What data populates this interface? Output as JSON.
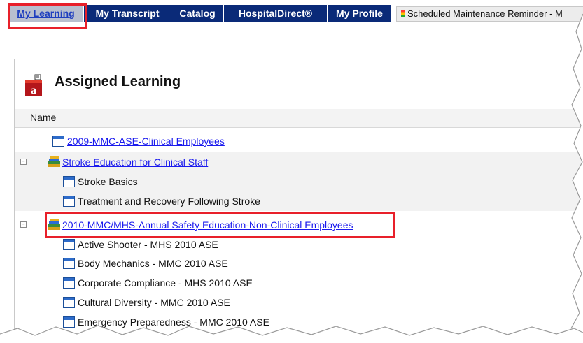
{
  "tabs": [
    {
      "label": "My Learning",
      "active": true
    },
    {
      "label": "My Transcript"
    },
    {
      "label": "Catalog"
    },
    {
      "label": "HospitalDirect®"
    },
    {
      "label": "My Profile"
    }
  ],
  "notice": {
    "text": "Scheduled Maintenance Reminder - M"
  },
  "section": {
    "title": "Assigned Learning",
    "column_header": "Name"
  },
  "items": {
    "item1": "2009-MMC-ASE-Clinical Employees",
    "group1": "Stroke Education for Clinical Staff",
    "group1_children": [
      "Stroke Basics",
      "Treatment and Recovery Following Stroke"
    ],
    "group2": "2010-MMC/MHS-Annual Safety Education-Non-Clinical Employees",
    "group2_children": [
      "Active Shooter - MHS 2010 ASE",
      "Body Mechanics - MMC 2010 ASE",
      "Corporate Compliance - MHS 2010 ASE",
      "Cultural Diversity - MMC 2010 ASE",
      "Emergency Preparedness - MMC 2010 ASE"
    ]
  },
  "colors": {
    "tab_bg": "#0a2a78",
    "highlight": "#e8202a",
    "link": "#1a1aee"
  }
}
